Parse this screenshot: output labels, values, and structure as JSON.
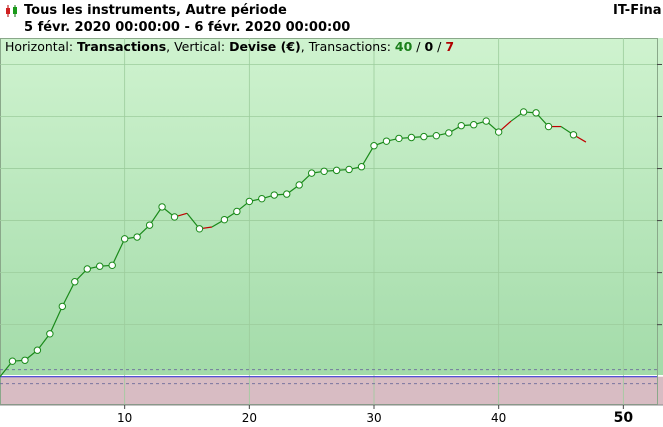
{
  "header": {
    "title": "Tous les instruments, Autre période",
    "period": "5 févr. 2020 00:00:00 - 6 févr. 2020 00:00:00",
    "brand": "IT-Fina"
  },
  "info": {
    "horizontal_label": "Horizontal: ",
    "horizontal_value": "Transactions",
    "vertical_label": ", Vertical: ",
    "vertical_value": "Devise (€)",
    "transactions_label": ", Transactions: ",
    "wins": "40",
    "sep1": " / ",
    "neutral": "0",
    "sep2": " / ",
    "losses": "7"
  },
  "colors": {
    "bg_top": "#cff3cf",
    "bg_bottom": "#a3dba9",
    "negative_zone": "#d8bcc3",
    "win_line": "#1a8a1a",
    "loss_line": "#c00000",
    "grid": "#9ccc9c",
    "zero_line": "#3a3ad0"
  },
  "chart_data": {
    "type": "line",
    "xlabel": "",
    "ylabel": "",
    "xlim": [
      0,
      52.7
    ],
    "ylim": [
      -31,
      371
    ],
    "grid": true,
    "x_ticks": [
      10,
      20,
      30,
      40,
      50
    ],
    "y_ticks": [
      0,
      57,
      114,
      171,
      228,
      285,
      342
    ],
    "x": [
      0,
      1,
      2,
      3,
      4,
      5,
      6,
      7,
      8,
      9,
      10,
      11,
      12,
      13,
      14,
      15,
      16,
      17,
      18,
      19,
      20,
      21,
      22,
      23,
      24,
      25,
      26,
      27,
      28,
      29,
      30,
      31,
      32,
      33,
      34,
      35,
      36,
      37,
      38,
      39,
      40,
      41,
      42,
      43,
      44,
      45,
      46,
      47
    ],
    "values": [
      0,
      17,
      18,
      29,
      47,
      77,
      104,
      118,
      121,
      122,
      151,
      153,
      166,
      186,
      175,
      179,
      162,
      164,
      172,
      181,
      192,
      195,
      199,
      200,
      210,
      223,
      225,
      226,
      227,
      230,
      253,
      258,
      261,
      262,
      263,
      264,
      267,
      275,
      276,
      280,
      268,
      280,
      290,
      289,
      274,
      274,
      265,
      257
    ],
    "loss_segments": [
      14,
      16,
      40,
      44,
      46,
      47
    ]
  }
}
